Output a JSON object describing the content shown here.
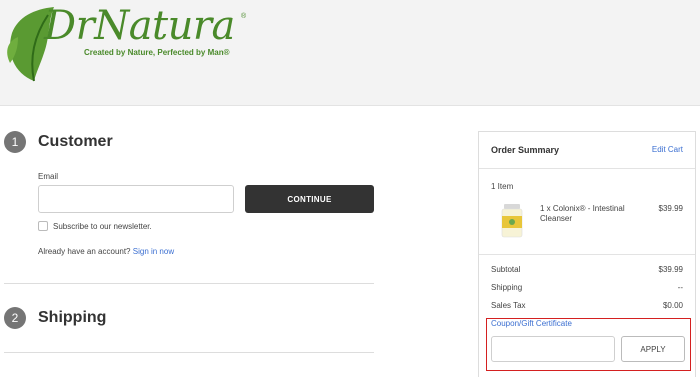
{
  "brand": {
    "name": "DrNatura",
    "registered": "®",
    "tagline": "Created by Nature, Perfected by Man®",
    "primary_color": "#4a8a2a"
  },
  "customer": {
    "step_number": "1",
    "title": "Customer",
    "email_label": "Email",
    "email_value": "",
    "continue_label": "CONTINUE",
    "newsletter_label": "Subscribe to our newsletter.",
    "newsletter_checked": false,
    "account_prompt": "Already have an account?",
    "sign_in_label": "Sign in now"
  },
  "shipping": {
    "step_number": "2",
    "title": "Shipping"
  },
  "order_summary": {
    "title": "Order Summary",
    "edit_cart_label": "Edit Cart",
    "item_count": "1 Item",
    "items": [
      {
        "name": "1 x Colonix® - Intestinal Cleanser",
        "price": "$39.99"
      }
    ],
    "subtotal_label": "Subtotal",
    "subtotal_value": "$39.99",
    "shipping_label": "Shipping",
    "shipping_value": "--",
    "tax_label": "Sales Tax",
    "tax_value": "$0.00",
    "coupon_label": "Coupon/Gift Certificate",
    "coupon_value": "",
    "apply_label": "APPLY"
  },
  "colors": {
    "link": "#3b6fd1",
    "button_dark": "#333333",
    "highlight_border": "#d42020",
    "step_badge": "#757575"
  }
}
